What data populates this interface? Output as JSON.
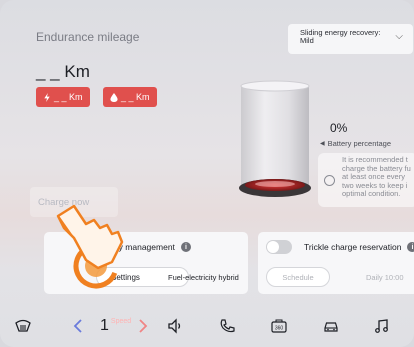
{
  "header": {
    "title": "Endurance mileage",
    "mileage": "_ _ Km"
  },
  "pills": [
    {
      "icon": "lightning-icon",
      "label": "_ _ Km"
    },
    {
      "icon": "fuel-drop-icon",
      "label": "_ _ Km"
    }
  ],
  "energy_recovery": {
    "label": "Sliding energy recovery:",
    "value": "Mild"
  },
  "battery": {
    "percent": "0%",
    "label": "Battery percentage",
    "tip": [
      "It is recommended t",
      "charge the battery fu",
      "at least once every",
      "two weeks to keep i",
      "optimal condition."
    ]
  },
  "charge_now": "Charge now",
  "energy_card": {
    "title": "Energy management",
    "button": "Settings",
    "mode": "Fuel-electricity hybrid"
  },
  "trickle_card": {
    "title": "Trickle charge reservation",
    "button": "Schedule",
    "time": "Daily 10:00"
  },
  "bottom_bar": {
    "speed_value": "1",
    "speed_label": "Speed"
  },
  "colors": {
    "accent_red": "#e0504d",
    "highlight_orange": "#f08020"
  }
}
